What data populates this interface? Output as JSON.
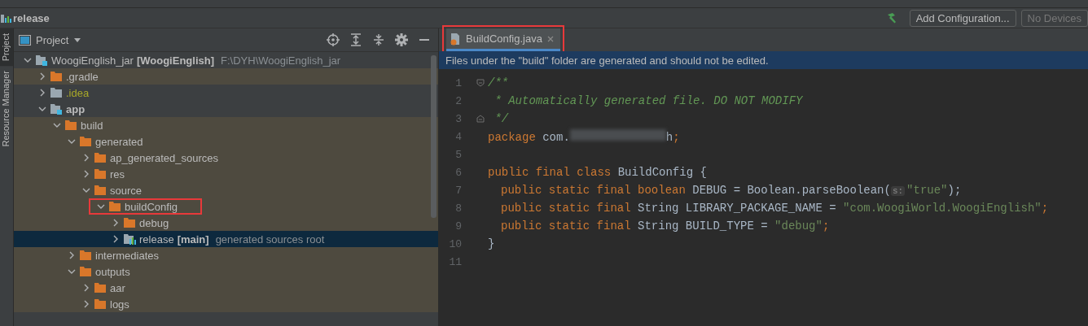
{
  "navbar": {
    "title": "release",
    "actions": [
      {
        "kind": "build"
      },
      {
        "kind": "button",
        "label": "Add Configuration...",
        "disabled": false
      },
      {
        "kind": "button",
        "label": "No Devices",
        "disabled": true
      }
    ]
  },
  "side_strip": {
    "tabs": [
      {
        "label": "Project",
        "selected": true
      },
      {
        "label": "Resource Manager",
        "selected": false
      }
    ]
  },
  "project_panel": {
    "title": "Project",
    "tree": [
      {
        "name": "WoogiEnglish_jar",
        "tag": "[WoogiEnglish]",
        "hint": "F:\\DYH\\WoogiEnglish_jar",
        "kind": "module",
        "bold": false,
        "excluded": false,
        "ignored": false,
        "expanded": true,
        "selected": false,
        "highlighted": false,
        "children": [
          {
            "name": ".gradle",
            "kind": "folder",
            "bold": false,
            "excluded": true,
            "ignored": false,
            "expanded": false,
            "selected": false,
            "highlighted": false
          },
          {
            "name": ".idea",
            "kind": "plain-folder",
            "bold": false,
            "excluded": false,
            "ignored": true,
            "expanded": false,
            "selected": false,
            "highlighted": false
          },
          {
            "name": "app",
            "kind": "module",
            "bold": true,
            "excluded": false,
            "ignored": false,
            "expanded": true,
            "selected": false,
            "highlighted": false,
            "children": [
              {
                "name": "build",
                "kind": "folder",
                "bold": false,
                "excluded": true,
                "ignored": false,
                "expanded": true,
                "selected": false,
                "highlighted": false,
                "children": [
                  {
                    "name": "generated",
                    "kind": "folder",
                    "bold": false,
                    "excluded": true,
                    "ignored": false,
                    "expanded": true,
                    "selected": false,
                    "highlighted": false,
                    "children": [
                      {
                        "name": "ap_generated_sources",
                        "kind": "folder",
                        "bold": false,
                        "excluded": true,
                        "ignored": false,
                        "expanded": false,
                        "selected": false,
                        "highlighted": false
                      },
                      {
                        "name": "res",
                        "kind": "folder",
                        "bold": false,
                        "excluded": true,
                        "ignored": false,
                        "expanded": false,
                        "selected": false,
                        "highlighted": false
                      },
                      {
                        "name": "source",
                        "kind": "folder",
                        "bold": false,
                        "excluded": true,
                        "ignored": false,
                        "expanded": true,
                        "selected": false,
                        "highlighted": false,
                        "children": [
                          {
                            "name": "buildConfig",
                            "kind": "folder",
                            "bold": false,
                            "excluded": true,
                            "ignored": false,
                            "expanded": true,
                            "selected": false,
                            "highlighted": true,
                            "children": [
                              {
                                "name": "debug",
                                "kind": "folder",
                                "bold": false,
                                "excluded": true,
                                "ignored": false,
                                "expanded": false,
                                "selected": false,
                                "highlighted": false
                              },
                              {
                                "name": "release",
                                "tag": "[main]",
                                "hint": "generated sources root",
                                "kind": "source-root",
                                "bold": false,
                                "excluded": false,
                                "ignored": false,
                                "expanded": false,
                                "selected": true,
                                "highlighted": false
                              }
                            ]
                          }
                        ]
                      }
                    ]
                  },
                  {
                    "name": "intermediates",
                    "kind": "folder",
                    "bold": false,
                    "excluded": true,
                    "ignored": false,
                    "expanded": false,
                    "selected": false,
                    "highlighted": false
                  },
                  {
                    "name": "outputs",
                    "kind": "folder",
                    "bold": false,
                    "excluded": true,
                    "ignored": false,
                    "expanded": true,
                    "selected": false,
                    "highlighted": false,
                    "children": [
                      {
                        "name": "aar",
                        "kind": "folder",
                        "bold": false,
                        "excluded": true,
                        "ignored": false,
                        "expanded": false,
                        "selected": false,
                        "highlighted": false
                      },
                      {
                        "name": "logs",
                        "kind": "folder",
                        "bold": false,
                        "excluded": true,
                        "ignored": false,
                        "expanded": false,
                        "selected": false,
                        "highlighted": false
                      }
                    ]
                  }
                ]
              }
            ]
          }
        ]
      }
    ]
  },
  "editor": {
    "tabs": [
      {
        "label": "BuildConfig.java",
        "selected": true,
        "highlighted": true
      }
    ],
    "banner": "Files under the \"build\" folder are generated and should not be edited.",
    "lines": [
      {
        "number": "1",
        "kind": "fold-start",
        "tokens": [
          {
            "kind": "comment",
            "text": "/**"
          }
        ]
      },
      {
        "number": "2",
        "kind": "code",
        "tokens": [
          {
            "kind": "comment",
            "text": " * Automatically generated file. DO NOT MODIFY"
          }
        ]
      },
      {
        "number": "3",
        "kind": "fold-end",
        "tokens": [
          {
            "kind": "comment",
            "text": " */"
          }
        ]
      },
      {
        "number": "4",
        "kind": "code",
        "tokens": [
          {
            "kind": "keyword",
            "text": "package"
          },
          {
            "kind": "plain",
            "text": " com."
          },
          {
            "kind": "redacted"
          },
          {
            "kind": "plain",
            "text": "h"
          },
          {
            "kind": "keyword",
            "text": ";"
          }
        ]
      },
      {
        "number": "5",
        "kind": "code"
      },
      {
        "number": "6",
        "kind": "code",
        "tokens": [
          {
            "kind": "keyword",
            "text": "public final class"
          },
          {
            "kind": "plain",
            "text": " BuildConfig {"
          }
        ]
      },
      {
        "number": "7",
        "kind": "member",
        "tokens": [
          {
            "kind": "keyword",
            "text": "public static final boolean"
          },
          {
            "kind": "plain",
            "text": " DEBUG = Boolean.parseBoolean("
          },
          {
            "kind": "hint",
            "text": "s:"
          },
          {
            "kind": "string",
            "text": "\"true\""
          },
          {
            "kind": "plain",
            "text": ");"
          }
        ]
      },
      {
        "number": "8",
        "kind": "member",
        "tokens": [
          {
            "kind": "keyword",
            "text": "public static final"
          },
          {
            "kind": "plain",
            "text": " String LIBRARY_PACKAGE_NAME = "
          },
          {
            "kind": "string",
            "text": "\"com.WoogiWorld.WoogiEnglish\""
          },
          {
            "kind": "keyword",
            "text": ";"
          }
        ]
      },
      {
        "number": "9",
        "kind": "member",
        "tokens": [
          {
            "kind": "keyword",
            "text": "public static final"
          },
          {
            "kind": "plain",
            "text": " String BUILD_TYPE = "
          },
          {
            "kind": "string",
            "text": "\"debug\""
          },
          {
            "kind": "keyword",
            "text": ";"
          }
        ]
      },
      {
        "number": "10",
        "kind": "code",
        "tokens": [
          {
            "kind": "plain",
            "text": "}"
          }
        ]
      },
      {
        "number": "11",
        "kind": "code"
      }
    ]
  }
}
